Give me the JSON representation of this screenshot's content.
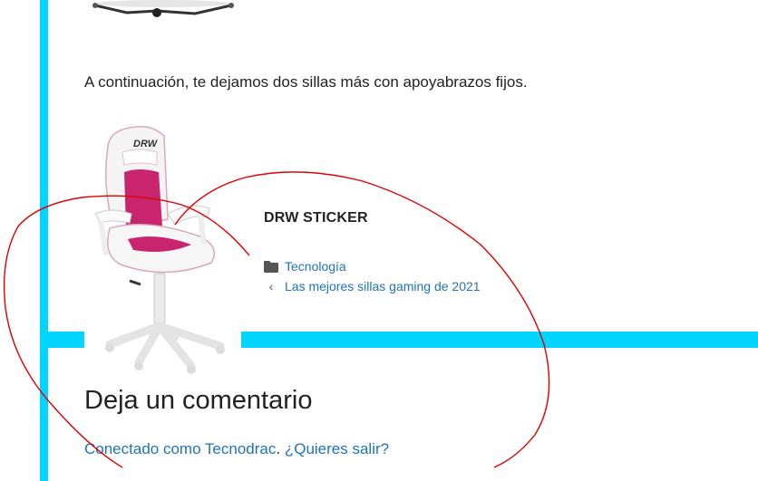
{
  "article": {
    "intro_text": "A continuación, te dejamos dos sillas más con apoyabrazos fijos.",
    "product_title": "DRW STICKER"
  },
  "post_meta": {
    "category_icon": "folder-icon",
    "category_label": "Tecnología",
    "prev_icon": "chevron-left-icon",
    "prev_post_label": "Las mejores sillas gaming de 2021"
  },
  "comments": {
    "title": "Deja un comentario",
    "logged_in_as": "Conectado como Tecnodrac",
    "separator": ".",
    "logout_label": "¿Quieres salir?"
  },
  "colors": {
    "accent_bar": "#00d4ff",
    "link": "#1e73be",
    "scribble": "#e00000",
    "chair_pink": "#c8256e"
  }
}
